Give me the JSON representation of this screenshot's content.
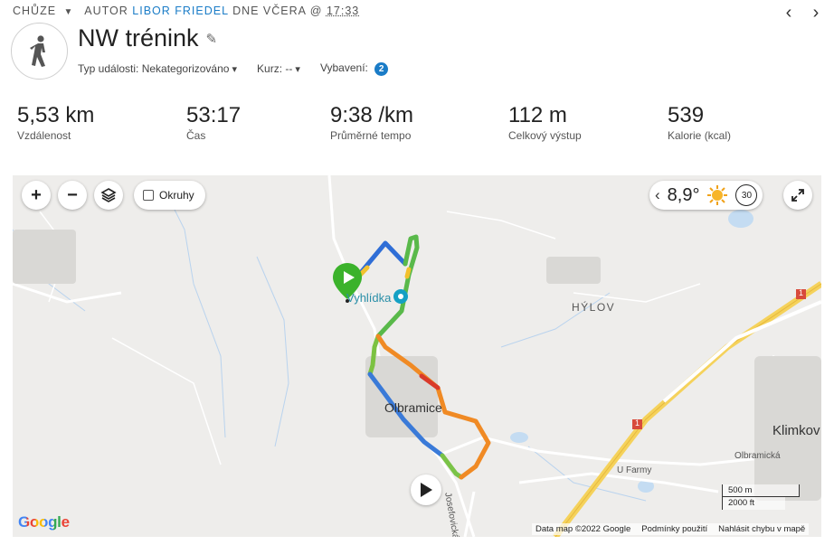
{
  "header": {
    "activity_type": "CHŮZE",
    "author_prefix": "AUTOR",
    "author_name": "LIBOR FRIEDEL",
    "date_prefix": "DNE VČERA @",
    "time": "17:33",
    "title": "NW trénink"
  },
  "meta": {
    "event_type_label": "Typ události: Nekategorizováno",
    "course_label": "Kurz: --",
    "gear_label": "Vybavení:",
    "gear_count": "2"
  },
  "stats": [
    {
      "value": "5,53 km",
      "label": "Vzdálenost"
    },
    {
      "value": "53:17",
      "label": "Čas"
    },
    {
      "value": "9:38 /km",
      "label": "Průměrné tempo"
    },
    {
      "value": "112 m",
      "label": "Celkový výstup"
    },
    {
      "value": "539",
      "label": "Kalorie (kcal)"
    }
  ],
  "map": {
    "zoom_in": "+",
    "zoom_out": "−",
    "laps_label": "Okruhy",
    "temperature": "8,9°",
    "weather_timer": "30",
    "labels": {
      "vyhlidka": "Vyhlídka",
      "hylov": "HÝLOV",
      "olbramice": "Olbramice",
      "klimkovice": "Klimkov",
      "olbramicka": "Olbramická",
      "u_farmy": "U Farmy",
      "josefovicka": "Josefovická",
      "road1a": "1",
      "road1b": "1"
    },
    "google_logo": "Google",
    "attribution": {
      "data": "Data map ©2022 Google",
      "terms": "Podmínky použití",
      "report": "Nahlásit chybu v mapě"
    },
    "scale": {
      "metric": "500 m",
      "imperial": "2000 ft"
    }
  },
  "colors": {
    "accent": "#1a7cc7",
    "start_marker": "#3bb22b"
  }
}
